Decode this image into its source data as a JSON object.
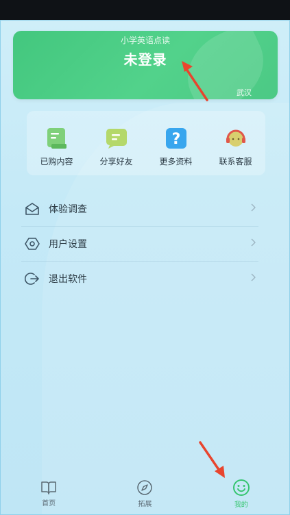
{
  "banner": {
    "app_name": "小学英语点读",
    "login_status": "未登录",
    "city": "武汉"
  },
  "quick_actions": [
    {
      "label": "已购内容",
      "icon": "document-icon"
    },
    {
      "label": "分享好友",
      "icon": "chat-bubble-icon"
    },
    {
      "label": "更多资料",
      "icon": "question-mark-icon"
    },
    {
      "label": "联系客服",
      "icon": "headset-icon"
    }
  ],
  "menu": [
    {
      "label": "体验调查",
      "icon": "envelope-icon"
    },
    {
      "label": "用户设置",
      "icon": "hexagon-settings-icon"
    },
    {
      "label": "退出软件",
      "icon": "logout-icon"
    }
  ],
  "tabbar": [
    {
      "label": "首页",
      "icon": "book-icon",
      "active": false
    },
    {
      "label": "拓展",
      "icon": "compass-icon",
      "active": false
    },
    {
      "label": "我的",
      "icon": "smiley-icon",
      "active": true
    }
  ],
  "colors": {
    "accent": "#35c56f",
    "banner": "#4cc985",
    "background": "#c4e9f7",
    "annotation_arrow": "#e8452e"
  }
}
